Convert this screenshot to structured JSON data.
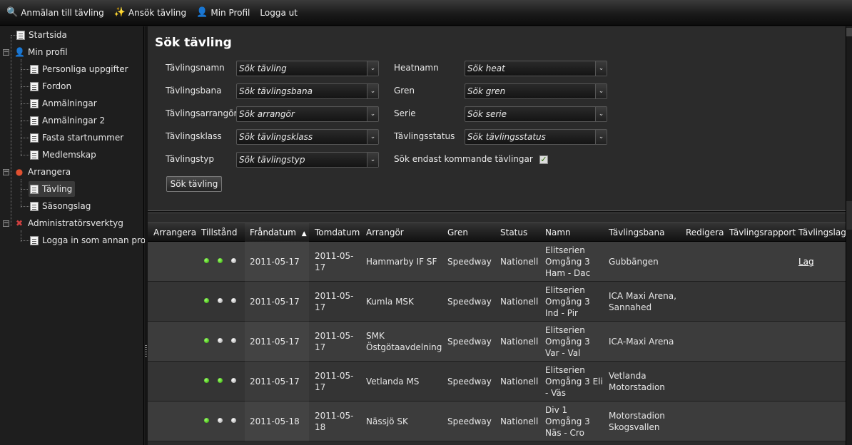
{
  "toolbar": {
    "items": [
      {
        "label": "Anmälan till tävling",
        "icon": "magnifier-icon"
      },
      {
        "label": "Ansök tävling",
        "icon": "magic-wand-icon"
      },
      {
        "label": "Min Profil",
        "icon": "user-icon"
      },
      {
        "label": "Logga ut",
        "icon": ""
      }
    ]
  },
  "sidebar": {
    "items": [
      {
        "label": "Startsida",
        "icon": "document-icon",
        "level": 0
      },
      {
        "label": "Min profil",
        "icon": "user-icon",
        "level": 0
      },
      {
        "label": "Personliga uppgifter",
        "icon": "document-icon",
        "level": 1
      },
      {
        "label": "Fordon",
        "icon": "document-icon",
        "level": 1
      },
      {
        "label": "Anmälningar",
        "icon": "document-icon",
        "level": 1
      },
      {
        "label": "Anmälningar 2",
        "icon": "document-icon",
        "level": 1
      },
      {
        "label": "Fasta startnummer",
        "icon": "document-icon",
        "level": 1
      },
      {
        "label": "Medlemskap",
        "icon": "document-icon",
        "level": 1
      },
      {
        "label": "Arrangera",
        "icon": "traffic-light-icon",
        "level": 0
      },
      {
        "label": "Tävling",
        "icon": "document-icon",
        "level": 1,
        "selected": true
      },
      {
        "label": "Säsongslag",
        "icon": "document-icon",
        "level": 1
      },
      {
        "label": "Administratörsverktyg",
        "icon": "tools-icon",
        "level": 0
      },
      {
        "label": "Logga in som annan profil",
        "icon": "document-icon",
        "level": 1
      }
    ]
  },
  "search": {
    "title": "Sök tävling",
    "fields_left": [
      {
        "label": "Tävlingsnamn",
        "placeholder": "Sök tävling"
      },
      {
        "label": "Tävlingsbana",
        "placeholder": "Sök tävlingsbana"
      },
      {
        "label": "Tävlingsarrangör",
        "placeholder": "Sök arrangör"
      },
      {
        "label": "Tävlingsklass",
        "placeholder": "Sök tävlingsklass"
      },
      {
        "label": "Tävlingstyp",
        "placeholder": "Sök tävlingstyp"
      }
    ],
    "fields_right": [
      {
        "label": "Heatnamn",
        "placeholder": "Sök heat"
      },
      {
        "label": "Gren",
        "placeholder": "Sök gren"
      },
      {
        "label": "Serie",
        "placeholder": "Sök serie"
      },
      {
        "label": "Tävlingsstatus",
        "placeholder": "Sök tävlingsstatus"
      }
    ],
    "upcoming_label": "Sök endast kommande tävlingar",
    "upcoming_checked": true,
    "button_label": "Sök tävling"
  },
  "grid": {
    "columns": [
      "Arrangera",
      "Tillstånd",
      "Fråndatum",
      "Tomdatum",
      "Arrangör",
      "Gren",
      "Status",
      "Namn",
      "Tävlingsbana",
      "Redigera",
      "Tävlingsrapport",
      "Tävlingslag"
    ],
    "sorted_column": "Fråndatum",
    "sort_indicator": "^",
    "rows": [
      {
        "state": [
          "green",
          "green",
          "gray"
        ],
        "from": "2011-05-17",
        "to": [
          "2011-05-",
          "17"
        ],
        "organizer": [
          "Hammarby IF SF"
        ],
        "branch": "Speedway",
        "status": "Nationell",
        "name": [
          "Elitserien",
          "Omgång 3",
          "Ham - Dac"
        ],
        "track": [
          "Gubbängen"
        ],
        "team": "Lag"
      },
      {
        "state": [
          "green",
          "gray",
          "gray"
        ],
        "from": "2011-05-17",
        "to": [
          "2011-05-",
          "17"
        ],
        "organizer": [
          "Kumla MSK"
        ],
        "branch": "Speedway",
        "status": "Nationell",
        "name": [
          "Elitserien",
          "Omgång 3",
          "Ind - Pir"
        ],
        "track": [
          "ICA Maxi Arena,",
          "Sannahed"
        ],
        "team": ""
      },
      {
        "state": [
          "green",
          "gray",
          "gray"
        ],
        "from": "2011-05-17",
        "to": [
          "2011-05-",
          "17"
        ],
        "organizer": [
          "SMK",
          "Östgötaavdelning"
        ],
        "branch": "Speedway",
        "status": "Nationell",
        "name": [
          "Elitserien",
          "Omgång 3",
          "Var - Val"
        ],
        "track": [
          "ICA-Maxi Arena"
        ],
        "team": ""
      },
      {
        "state": [
          "green",
          "green",
          "gray"
        ],
        "from": "2011-05-17",
        "to": [
          "2011-05-",
          "17"
        ],
        "organizer": [
          "Vetlanda MS"
        ],
        "branch": "Speedway",
        "status": "Nationell",
        "name": [
          "Elitserien",
          "Omgång 3 Eli",
          "- Väs"
        ],
        "track": [
          "Vetlanda",
          "Motorstadion"
        ],
        "team": ""
      },
      {
        "state": [
          "green",
          "gray",
          "gray"
        ],
        "from": "2011-05-18",
        "to": [
          "2011-05-",
          "18"
        ],
        "organizer": [
          "Nässjö SK"
        ],
        "branch": "Speedway",
        "status": "Nationell",
        "name": [
          "Div 1",
          "Omgång 3",
          "Näs - Cro"
        ],
        "track": [
          "Motorstadion",
          "Skogsvallen"
        ],
        "team": ""
      }
    ]
  },
  "colors": {
    "green_dot": "#3fc400",
    "gray_dot": "#bdbdbd",
    "background": "#2b2b2b"
  }
}
